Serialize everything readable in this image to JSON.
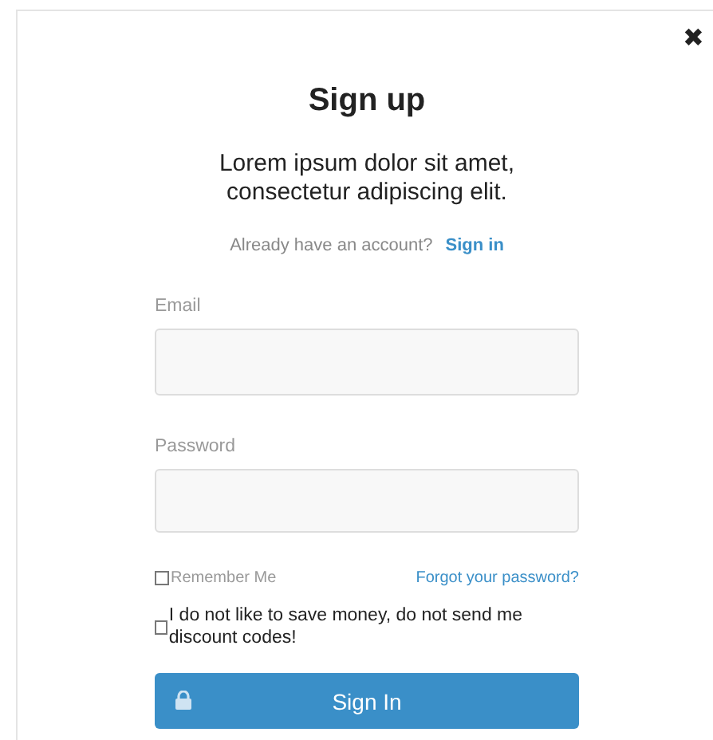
{
  "close_label": "✖",
  "title": "Sign up",
  "subtitle": "Lorem ipsum dolor sit amet, consectetur adipiscing elit.",
  "account_prompt": {
    "text": "Already have an account?",
    "link": "Sign in"
  },
  "fields": [
    {
      "label": "Email"
    },
    {
      "label": "Password"
    }
  ],
  "remember": {
    "label": "Remember Me",
    "checked": false
  },
  "forgot_link": "Forgot your password?",
  "opt_out": {
    "label": "I do not like to save money, do not send me discount codes!",
    "checked": false
  },
  "submit": "Sign In"
}
